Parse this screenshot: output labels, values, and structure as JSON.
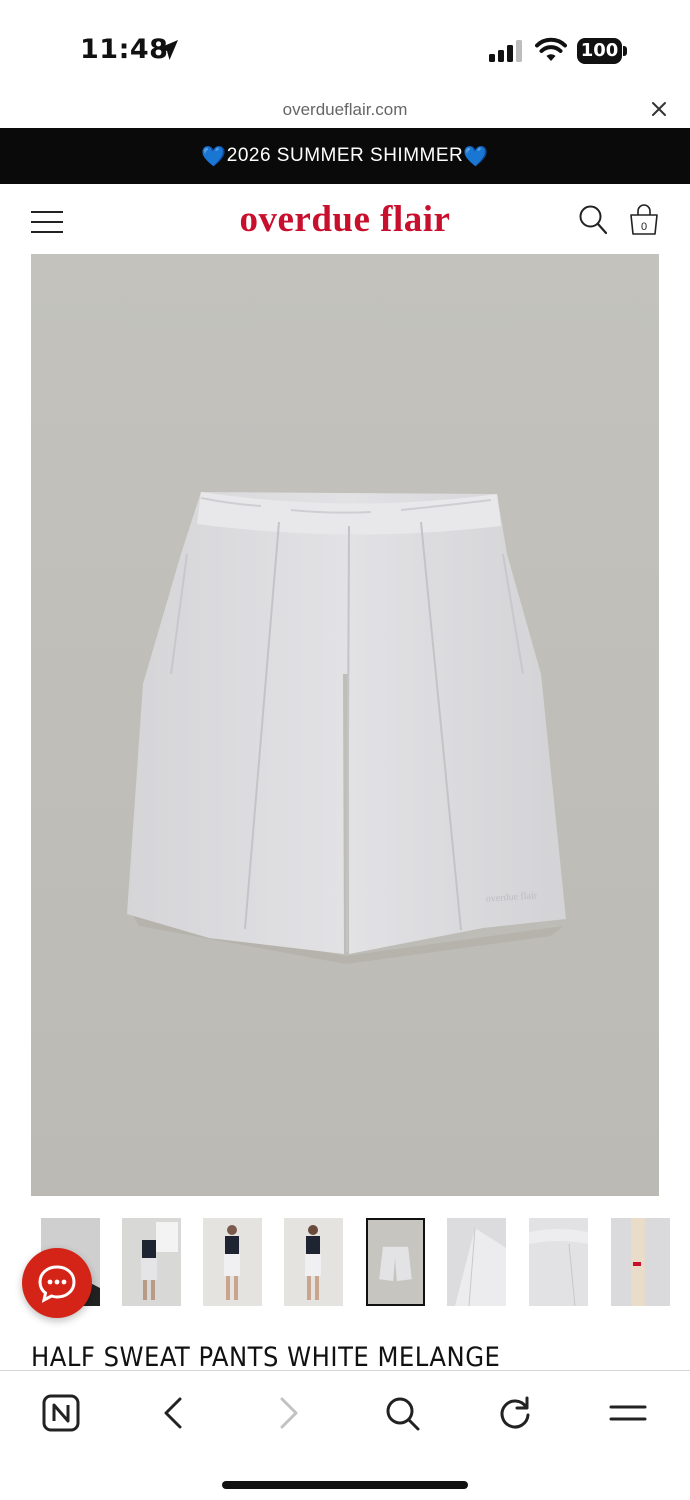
{
  "status_bar": {
    "time": "11:48",
    "battery": "100",
    "icons": [
      "location-arrow-icon",
      "cellular-signal-icon",
      "wifi-icon",
      "battery-icon"
    ]
  },
  "browser": {
    "url": "overdueflair.com",
    "close_icon": "close-icon"
  },
  "promo_banner": {
    "text": "2026 SUMMER SHIMMER",
    "emoji": "💙",
    "background": "#0a0a0a"
  },
  "header": {
    "logo": "overdue flair",
    "logo_color": "#c8102e",
    "cart_count": "0",
    "icons": [
      "hamburger-menu-icon",
      "search-icon",
      "shopping-bag-icon"
    ]
  },
  "product": {
    "main_image_alt": "light grey half sweat pants with pintuck seams and elastic waistband",
    "garment_embroidery": "overdue flair",
    "thumbnails": [
      {
        "id": "t1",
        "selected": false
      },
      {
        "id": "t2",
        "selected": false
      },
      {
        "id": "t3",
        "selected": false
      },
      {
        "id": "t4",
        "selected": false
      },
      {
        "id": "t5",
        "selected": true
      },
      {
        "id": "t6",
        "selected": false
      },
      {
        "id": "t7",
        "selected": false
      },
      {
        "id": "t8",
        "selected": false
      }
    ],
    "title": "HALF SWEAT PANTS  WHITE MELANGE"
  },
  "chat": {
    "icon": "chat-bubble-icon",
    "color": "#d42417"
  },
  "toolbar": {
    "buttons": [
      "naver-home-icon",
      "back-icon",
      "forward-icon",
      "search-icon",
      "reload-icon",
      "menu-icon"
    ]
  }
}
